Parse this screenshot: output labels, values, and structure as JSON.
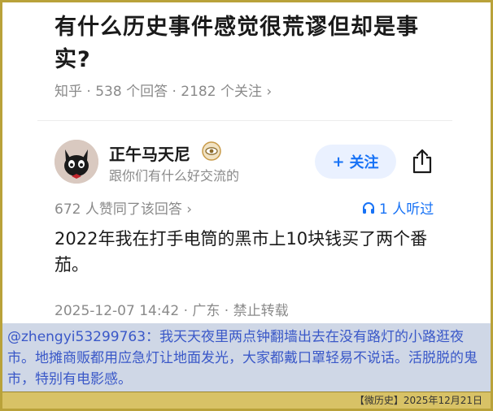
{
  "question": {
    "title": "有什么历史事件感觉很荒谬但却是事实?",
    "meta": "知乎 · 538 个回答 · 2182 个关注 ›"
  },
  "author": {
    "name": "正午马天尼",
    "bio": "跟你们有什么好交流的",
    "follow_label": "关注"
  },
  "stats": {
    "upvotes": "672 人赞同了该回答 ›",
    "listeners": "1 人听过"
  },
  "answer": {
    "text": "2022年我在打手电筒的黑市上10块钱买了两个番茄。",
    "meta": "2025-12-07 14:42 · 广东 · 禁止转载"
  },
  "comment": {
    "text": "@zhengyi53299763：我天天夜里两点钟翻墙出去在没有路灯的小路逛夜市。地摊商贩都用应急灯让地面发光，大家都戴口罩轻易不说话。活脱脱的鬼市，特别有电影感。"
  },
  "footer": {
    "text": "【微历史】2025年12月21日"
  },
  "colors": {
    "accent": "#1772f6",
    "frame": "#b9a23a",
    "comment_bg": "#cfd7e6",
    "comment_text": "#3a58c8"
  }
}
